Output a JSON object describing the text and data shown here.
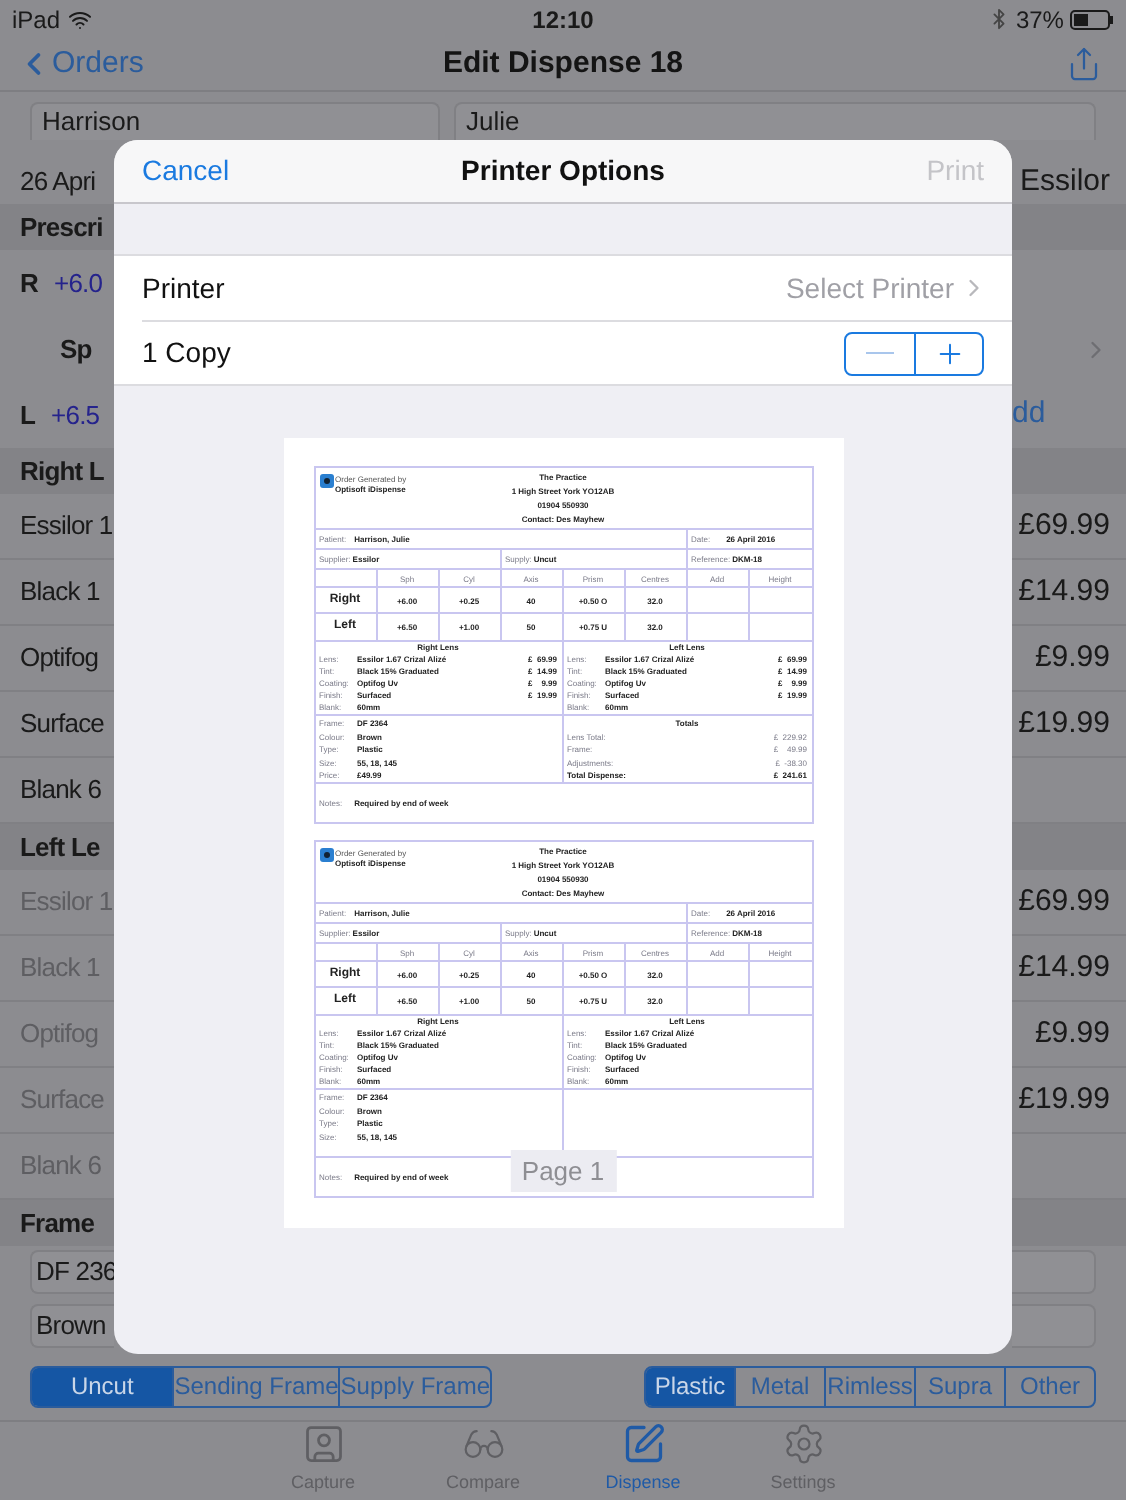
{
  "status_bar": {
    "device": "iPad",
    "time": "12:10",
    "battery": "37%"
  },
  "nav": {
    "back": "Orders",
    "title": "Edit Dispense 18"
  },
  "name_fields": [
    "Harrison",
    "Julie"
  ],
  "rows": [
    {
      "kind": "plain",
      "left": "26 Apri",
      "right": "Essilor"
    },
    {
      "kind": "header",
      "left": "Prescri"
    },
    {
      "kind": "rx",
      "left": "R",
      "value": "+6.0"
    },
    {
      "kind": "sub",
      "left": "Sp"
    },
    {
      "kind": "rx",
      "left": "L",
      "value": "+6.5",
      "right": "dd"
    },
    {
      "kind": "header",
      "left": "Right L"
    },
    {
      "kind": "item",
      "left": "Essilor 1",
      "right": "£69.99",
      "disabled": false
    },
    {
      "kind": "item",
      "left": "Black 1",
      "right": "£14.99",
      "disabled": false
    },
    {
      "kind": "item",
      "left": "Optifog",
      "right": "£9.99",
      "disabled": false
    },
    {
      "kind": "item",
      "left": "Surface",
      "right": "£19.99",
      "disabled": false
    },
    {
      "kind": "item",
      "left": "Blank 6",
      "disabled": false
    },
    {
      "kind": "header",
      "left": "Left Le"
    },
    {
      "kind": "item",
      "left": "Essilor 1",
      "right": "£69.99",
      "disabled": true
    },
    {
      "kind": "item",
      "left": "Black 1",
      "right": "£14.99",
      "disabled": true
    },
    {
      "kind": "item",
      "left": "Optifog",
      "right": "£9.99",
      "disabled": true
    },
    {
      "kind": "item",
      "left": "Surface",
      "right": "£19.99",
      "disabled": true
    },
    {
      "kind": "item",
      "left": "Blank 6",
      "disabled": true
    },
    {
      "kind": "header",
      "left": "Frame"
    },
    {
      "kind": "field",
      "left": "DF 236"
    },
    {
      "kind": "field",
      "left": "Brown"
    }
  ],
  "dialog": {
    "cancel": "Cancel",
    "title": "Printer Options",
    "print": {
      "label": "Print",
      "disabled": true
    },
    "printer": {
      "label": "Printer",
      "value": "Select Printer"
    },
    "copies": {
      "label": "1 Copy",
      "minus_disabled": true
    },
    "preview": {
      "page_label": "Page 1",
      "forms": [
        {
          "brand": [
            "Order Generated by",
            "Optisoft iDispense"
          ],
          "practice": [
            "The Practice",
            "1 High Street York YO12AB",
            "01904 550930",
            "Contact: Des Mayhew"
          ],
          "patient": {
            "label": "Patient:",
            "value": "Harrison, Julie"
          },
          "date": {
            "label": "Date:",
            "value": "26 April 2016"
          },
          "supplier": {
            "label": "Supplier:",
            "value": "Essilor"
          },
          "supply": {
            "label": "Supply:",
            "value": "Uncut"
          },
          "reference": {
            "label": "Reference:",
            "value": "DKM-18"
          },
          "rx_columns": [
            "Sph",
            "Cyl",
            "Axis",
            "Prism",
            "Centres",
            "Add",
            "Height"
          ],
          "rx_rows": [
            {
              "eye": "Right",
              "values": [
                "+6.00",
                "+0.25",
                "40",
                "+0.50 O",
                "32.0"
              ]
            },
            {
              "eye": "Left",
              "values": [
                "+6.50",
                "+1.00",
                "50",
                "+0.75 U",
                "32.0"
              ]
            }
          ],
          "lens_sections": [
            {
              "title": "Right Lens",
              "lines": [
                {
                  "label": "Lens:",
                  "value": "Essilor 1.67 Crizal Alizé",
                  "price": "£  69.99"
                },
                {
                  "label": "Tint:",
                  "value": "Black 15% Graduated",
                  "price": "£  14.99"
                },
                {
                  "label": "Coating:",
                  "value": "Optifog Uv",
                  "price": "£    9.99"
                },
                {
                  "label": "Finish:",
                  "value": "Surfaced",
                  "price": "£  19.99"
                },
                {
                  "label": "Blank:",
                  "value": "60mm"
                }
              ]
            },
            {
              "title": "Left Lens",
              "lines": [
                {
                  "label": "Lens:",
                  "value": "Essilor 1.67 Crizal Alizé",
                  "price": "£  69.99"
                },
                {
                  "label": "Tint:",
                  "value": "Black 15% Graduated",
                  "price": "£  14.99"
                },
                {
                  "label": "Coating:",
                  "value": "Optifog Uv",
                  "price": "£    9.99"
                },
                {
                  "label": "Finish:",
                  "value": "Surfaced",
                  "price": "£  19.99"
                },
                {
                  "label": "Blank:",
                  "value": "60mm"
                }
              ]
            }
          ],
          "frame_lines": [
            {
              "label": "Frame:",
              "value": "DF 2364"
            },
            {
              "label": "Colour:",
              "value": "Brown"
            },
            {
              "label": "Type:",
              "value": "Plastic"
            },
            {
              "label": "Size:",
              "value": "55, 18, 145"
            },
            {
              "label": "Price:",
              "value": "£49.99"
            }
          ],
          "totals": {
            "title": "Totals",
            "lines": [
              {
                "label": "Lens Total:",
                "value": "£  229.92",
                "bold": false
              },
              {
                "label": "Frame:",
                "value": "£    49.99",
                "bold": false
              },
              {
                "label": "Adjustments:",
                "value": "£  -38.30",
                "bold": false
              },
              {
                "label": "Total Dispense:",
                "value": "£  241.61",
                "bold": true
              }
            ]
          },
          "notes": {
            "label": "Notes:",
            "value": "Required by end of week"
          }
        },
        {
          "brand": [
            "Order Generated by",
            "Optisoft iDispense"
          ],
          "practice": [
            "The Practice",
            "1 High Street York YO12AB",
            "01904 550930",
            "Contact: Des Mayhew"
          ],
          "patient": {
            "label": "Patient:",
            "value": "Harrison, Julie"
          },
          "date": {
            "label": "Date:",
            "value": "26 April 2016"
          },
          "supplier": {
            "label": "Supplier:",
            "value": "Essilor"
          },
          "supply": {
            "label": "Supply:",
            "value": "Uncut"
          },
          "reference": {
            "label": "Reference:",
            "value": "DKM-18"
          },
          "rx_columns": [
            "Sph",
            "Cyl",
            "Axis",
            "Prism",
            "Centres",
            "Add",
            "Height"
          ],
          "rx_rows": [
            {
              "eye": "Right",
              "values": [
                "+6.00",
                "+0.25",
                "40",
                "+0.50 O",
                "32.0"
              ]
            },
            {
              "eye": "Left",
              "values": [
                "+6.50",
                "+1.00",
                "50",
                "+0.75 U",
                "32.0"
              ]
            }
          ],
          "lens_sections": [
            {
              "title": "Right Lens",
              "lines": [
                {
                  "label": "Lens:",
                  "value": "Essilor 1.67 Crizal Alizé"
                },
                {
                  "label": "Tint:",
                  "value": "Black 15% Graduated"
                },
                {
                  "label": "Coating:",
                  "value": "Optifog Uv"
                },
                {
                  "label": "Finish:",
                  "value": "Surfaced"
                },
                {
                  "label": "Blank:",
                  "value": "60mm"
                }
              ]
            },
            {
              "title": "Left Lens",
              "lines": [
                {
                  "label": "Lens:",
                  "value": "Essilor 1.67 Crizal Alizé"
                },
                {
                  "label": "Tint:",
                  "value": "Black 15% Graduated"
                },
                {
                  "label": "Coating:",
                  "value": "Optifog Uv"
                },
                {
                  "label": "Finish:",
                  "value": "Surfaced"
                },
                {
                  "label": "Blank:",
                  "value": "60mm"
                }
              ]
            }
          ],
          "frame_lines": [
            {
              "label": "Frame:",
              "value": "DF 2364"
            },
            {
              "label": "Colour:",
              "value": "Brown"
            },
            {
              "label": "Type:",
              "value": "Plastic"
            },
            {
              "label": "Size:",
              "value": "55, 18, 145"
            }
          ],
          "notes": {
            "label": "Notes:",
            "value": "Required by end of week"
          }
        }
      ]
    }
  },
  "supply_segments": [
    {
      "label": "Uncut",
      "selected": true
    },
    {
      "label": "Sending Frame",
      "selected": false
    },
    {
      "label": "Supply Frame",
      "selected": false
    }
  ],
  "material_segments": [
    {
      "label": "Plastic",
      "selected": true
    },
    {
      "label": "Metal",
      "selected": false
    },
    {
      "label": "Rimless",
      "selected": false
    },
    {
      "label": "Supra",
      "selected": false
    },
    {
      "label": "Other",
      "selected": false
    }
  ],
  "tab_bar": [
    {
      "kind": "capture",
      "label": "Capture",
      "selected": false
    },
    {
      "kind": "compare",
      "label": "Compare",
      "selected": false
    },
    {
      "kind": "dispense",
      "label": "Dispense",
      "selected": true
    },
    {
      "kind": "settings",
      "label": "Settings",
      "selected": false
    }
  ]
}
